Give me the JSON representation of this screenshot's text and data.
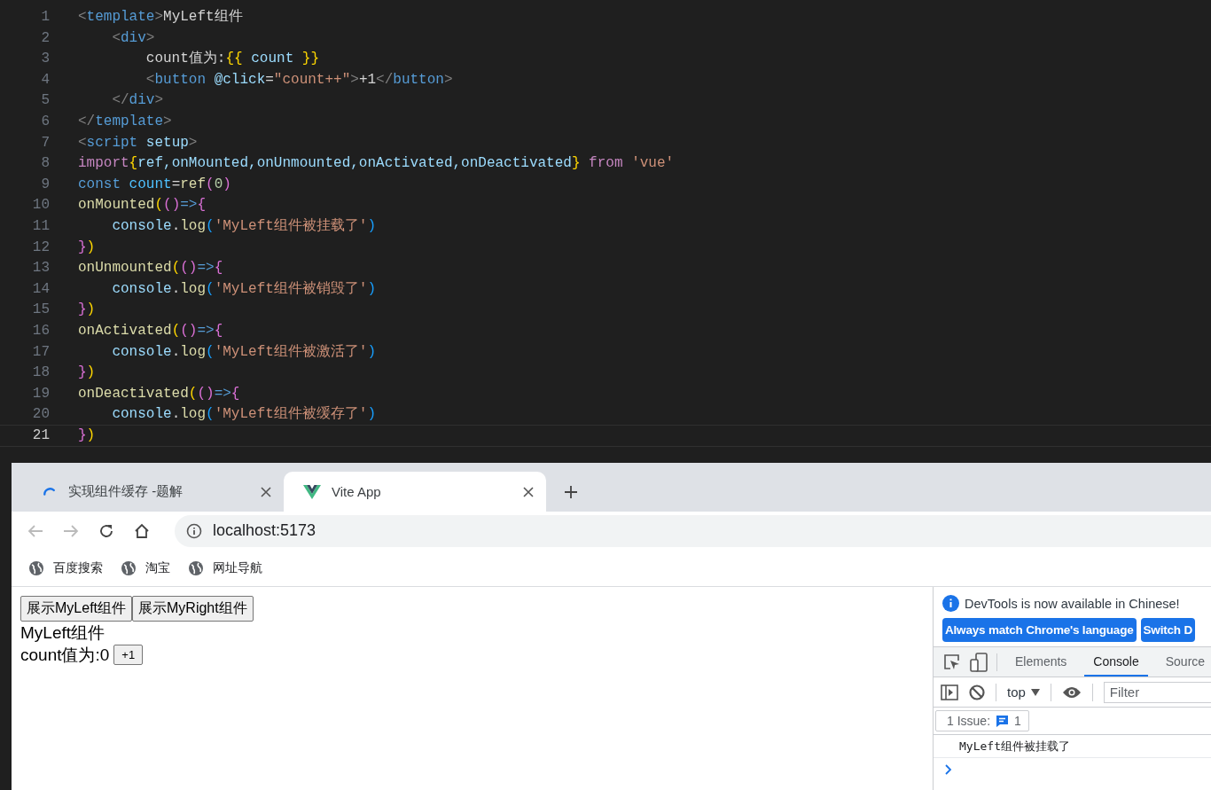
{
  "editor": {
    "lines": [
      {
        "n": "1",
        "current": false,
        "tokens": [
          {
            "t": "<",
            "kind": "punct"
          },
          {
            "t": "template",
            "kind": "tag"
          },
          {
            "t": ">",
            "kind": "punct"
          },
          {
            "t": "MyLeft组件",
            "kind": "text"
          }
        ]
      },
      {
        "n": "2",
        "current": false,
        "tokens": [
          {
            "t": "    <",
            "kind": "punct"
          },
          {
            "t": "div",
            "kind": "tag"
          },
          {
            "t": ">",
            "kind": "punct"
          }
        ]
      },
      {
        "n": "3",
        "current": false,
        "tokens": [
          {
            "t": "        count值为:",
            "kind": "text"
          },
          {
            "t": "{{",
            "kind": "brace"
          },
          {
            "t": " count ",
            "kind": "var"
          },
          {
            "t": "}}",
            "kind": "brace"
          }
        ]
      },
      {
        "n": "4",
        "current": false,
        "tokens": [
          {
            "t": "        <",
            "kind": "punct"
          },
          {
            "t": "button",
            "kind": "tag"
          },
          {
            "t": " @click",
            "kind": "var"
          },
          {
            "t": "=",
            "kind": "text"
          },
          {
            "t": "\"count++\"",
            "kind": "string"
          },
          {
            "t": ">",
            "kind": "punct"
          },
          {
            "t": "+1",
            "kind": "text"
          },
          {
            "t": "</",
            "kind": "punct"
          },
          {
            "t": "button",
            "kind": "tag"
          },
          {
            "t": ">",
            "kind": "punct"
          }
        ]
      },
      {
        "n": "5",
        "current": false,
        "tokens": [
          {
            "t": "    </",
            "kind": "punct"
          },
          {
            "t": "div",
            "kind": "tag"
          },
          {
            "t": ">",
            "kind": "punct"
          }
        ]
      },
      {
        "n": "6",
        "current": false,
        "tokens": [
          {
            "t": "</",
            "kind": "punct"
          },
          {
            "t": "template",
            "kind": "tag"
          },
          {
            "t": ">",
            "kind": "punct"
          }
        ]
      },
      {
        "n": "7",
        "current": false,
        "tokens": [
          {
            "t": "<",
            "kind": "punct"
          },
          {
            "t": "script",
            "kind": "tag"
          },
          {
            "t": " setup",
            "kind": "var"
          },
          {
            "t": ">",
            "kind": "punct"
          }
        ]
      },
      {
        "n": "8",
        "current": false,
        "tokens": [
          {
            "t": "import",
            "kind": "keyword"
          },
          {
            "t": "{",
            "kind": "brace"
          },
          {
            "t": "ref,onMounted,onUnmounted,onActivated,onDeactivated",
            "kind": "var"
          },
          {
            "t": "}",
            "kind": "brace"
          },
          {
            "t": " from ",
            "kind": "keyword"
          },
          {
            "t": "'vue'",
            "kind": "string"
          }
        ]
      },
      {
        "n": "9",
        "current": false,
        "tokens": [
          {
            "t": "const",
            "kind": "tag"
          },
          {
            "t": " count",
            "kind": "const"
          },
          {
            "t": "=",
            "kind": "text"
          },
          {
            "t": "ref",
            "kind": "func"
          },
          {
            "t": "(",
            "kind": "paren"
          },
          {
            "t": "0",
            "kind": "number"
          },
          {
            "t": ")",
            "kind": "paren"
          }
        ]
      },
      {
        "n": "10",
        "current": false,
        "tokens": [
          {
            "t": "onMounted",
            "kind": "func"
          },
          {
            "t": "(",
            "kind": "brace"
          },
          {
            "t": "()",
            "kind": "paren"
          },
          {
            "t": "=>",
            "kind": "tag"
          },
          {
            "t": "{",
            "kind": "paren"
          }
        ]
      },
      {
        "n": "11",
        "current": false,
        "tokens": [
          {
            "t": "    console",
            "kind": "var"
          },
          {
            "t": ".",
            "kind": "text"
          },
          {
            "t": "log",
            "kind": "func"
          },
          {
            "t": "(",
            "kind": "bracket"
          },
          {
            "t": "'MyLeft组件被挂载了'",
            "kind": "string"
          },
          {
            "t": ")",
            "kind": "bracket"
          }
        ]
      },
      {
        "n": "12",
        "current": false,
        "tokens": [
          {
            "t": "}",
            "kind": "paren"
          },
          {
            "t": ")",
            "kind": "brace"
          }
        ]
      },
      {
        "n": "13",
        "current": false,
        "tokens": [
          {
            "t": "onUnmounted",
            "kind": "func"
          },
          {
            "t": "(",
            "kind": "brace"
          },
          {
            "t": "()",
            "kind": "paren"
          },
          {
            "t": "=>",
            "kind": "tag"
          },
          {
            "t": "{",
            "kind": "paren"
          }
        ]
      },
      {
        "n": "14",
        "current": false,
        "tokens": [
          {
            "t": "    console",
            "kind": "var"
          },
          {
            "t": ".",
            "kind": "text"
          },
          {
            "t": "log",
            "kind": "func"
          },
          {
            "t": "(",
            "kind": "bracket"
          },
          {
            "t": "'MyLeft组件被销毁了'",
            "kind": "string"
          },
          {
            "t": ")",
            "kind": "bracket"
          }
        ]
      },
      {
        "n": "15",
        "current": false,
        "tokens": [
          {
            "t": "}",
            "kind": "paren"
          },
          {
            "t": ")",
            "kind": "brace"
          }
        ]
      },
      {
        "n": "16",
        "current": false,
        "tokens": [
          {
            "t": "onActivated",
            "kind": "func"
          },
          {
            "t": "(",
            "kind": "brace"
          },
          {
            "t": "()",
            "kind": "paren"
          },
          {
            "t": "=>",
            "kind": "tag"
          },
          {
            "t": "{",
            "kind": "paren"
          }
        ]
      },
      {
        "n": "17",
        "current": false,
        "tokens": [
          {
            "t": "    console",
            "kind": "var"
          },
          {
            "t": ".",
            "kind": "text"
          },
          {
            "t": "log",
            "kind": "func"
          },
          {
            "t": "(",
            "kind": "bracket"
          },
          {
            "t": "'MyLeft组件被激活了'",
            "kind": "string"
          },
          {
            "t": ")",
            "kind": "bracket"
          }
        ]
      },
      {
        "n": "18",
        "current": false,
        "tokens": [
          {
            "t": "}",
            "kind": "paren"
          },
          {
            "t": ")",
            "kind": "brace"
          }
        ]
      },
      {
        "n": "19",
        "current": false,
        "tokens": [
          {
            "t": "onDeactivated",
            "kind": "func"
          },
          {
            "t": "(",
            "kind": "brace"
          },
          {
            "t": "()",
            "kind": "paren"
          },
          {
            "t": "=>",
            "kind": "tag"
          },
          {
            "t": "{",
            "kind": "paren"
          }
        ]
      },
      {
        "n": "20",
        "current": false,
        "tokens": [
          {
            "t": "    console",
            "kind": "var"
          },
          {
            "t": ".",
            "kind": "text"
          },
          {
            "t": "log",
            "kind": "func"
          },
          {
            "t": "(",
            "kind": "bracket"
          },
          {
            "t": "'MyLeft组件被缓存了'",
            "kind": "string"
          },
          {
            "t": ")",
            "kind": "bracket"
          }
        ]
      },
      {
        "n": "21",
        "current": true,
        "tokens": [
          {
            "t": "}",
            "kind": "paren"
          },
          {
            "t": ")",
            "kind": "brace"
          }
        ]
      }
    ]
  },
  "browser": {
    "tabs": [
      {
        "title": "实现组件缓存 -题解",
        "kind": "loading",
        "selected": false
      },
      {
        "title": "Vite App",
        "kind": "site",
        "selected": true
      }
    ],
    "address": "localhost:5173",
    "bookmarks": [
      "百度搜索",
      "淘宝",
      "网址导航"
    ],
    "page": {
      "buttons": [
        "展示MyLeft组件",
        "展示MyRight组件"
      ],
      "heading": "MyLeft组件",
      "count_label": "count值为:0",
      "increment_button": "+1"
    },
    "devtools": {
      "notice": "DevTools is now available in Chinese!",
      "notice_buttons": [
        "Always match Chrome's language",
        "Switch D"
      ],
      "tabs": [
        {
          "label": "Elements",
          "selected": false
        },
        {
          "label": "Console",
          "selected": true
        },
        {
          "label": "Source",
          "selected": false
        }
      ],
      "context": "top",
      "filter_placeholder": "Filter",
      "issues_label": "1 Issue:",
      "issues_count": "1",
      "messages": [
        "MyLeft组件被挂载了"
      ]
    }
  }
}
